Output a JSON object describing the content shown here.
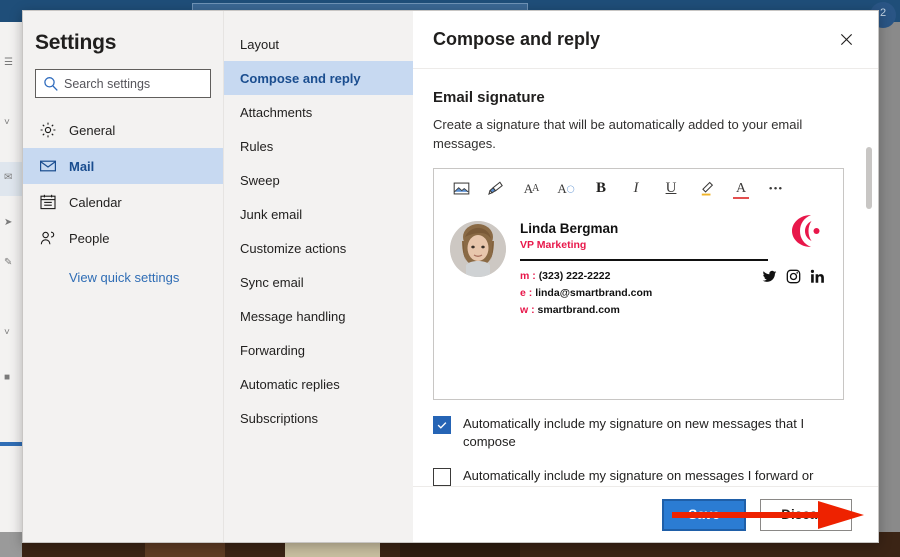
{
  "background": {
    "notification_badge": "2"
  },
  "settings": {
    "title": "Settings",
    "search": {
      "placeholder": "Search settings",
      "value": "",
      "icon": "search-icon"
    },
    "nav_items": [
      {
        "label": "General",
        "icon": "gear-icon",
        "selected": false
      },
      {
        "label": "Mail",
        "icon": "envelope-icon",
        "selected": true
      },
      {
        "label": "Calendar",
        "icon": "calendar-icon",
        "selected": false
      },
      {
        "label": "People",
        "icon": "people-icon",
        "selected": false
      }
    ],
    "quick_settings_link": "View quick settings",
    "subnav_items": [
      {
        "label": "Layout",
        "selected": false
      },
      {
        "label": "Compose and reply",
        "selected": true
      },
      {
        "label": "Attachments",
        "selected": false
      },
      {
        "label": "Rules",
        "selected": false
      },
      {
        "label": "Sweep",
        "selected": false
      },
      {
        "label": "Junk email",
        "selected": false
      },
      {
        "label": "Customize actions",
        "selected": false
      },
      {
        "label": "Sync email",
        "selected": false
      },
      {
        "label": "Message handling",
        "selected": false
      },
      {
        "label": "Forwarding",
        "selected": false
      },
      {
        "label": "Automatic replies",
        "selected": false
      },
      {
        "label": "Subscriptions",
        "selected": false
      }
    ]
  },
  "detail": {
    "title": "Compose and reply",
    "close_icon": "close-icon",
    "section_title": "Email signature",
    "section_description": "Create a signature that will be automatically added to your email messages.",
    "toolbar": [
      {
        "name": "insert-picture-icon",
        "glyph": "image"
      },
      {
        "name": "format-painter-icon",
        "glyph": "brush"
      },
      {
        "name": "font-size-icon",
        "glyph": "AA"
      },
      {
        "name": "font-grow-icon",
        "glyph": "A"
      },
      {
        "name": "bold-icon",
        "glyph": "B"
      },
      {
        "name": "italic-icon",
        "glyph": "I"
      },
      {
        "name": "underline-icon",
        "glyph": "U"
      },
      {
        "name": "highlight-icon",
        "glyph": "pen"
      },
      {
        "name": "font-color-icon",
        "glyph": "A"
      },
      {
        "name": "more-options-icon",
        "glyph": "•••"
      }
    ],
    "signature": {
      "name": "Linda Bergman",
      "role": "VP Marketing",
      "contacts": [
        {
          "key": "m",
          "value": "(323) 222-2222"
        },
        {
          "key": "e",
          "value": "linda@smartbrand.com"
        },
        {
          "key": "w",
          "value": "smartbrand.com"
        }
      ],
      "social": [
        "twitter-icon",
        "instagram-icon",
        "linkedin-icon"
      ],
      "brand_color": "#e8174a",
      "avatar_alt": "portrait-photo",
      "logo_alt": "smartbrand-logo"
    },
    "checkboxes": [
      {
        "label": "Automatically include my signature on new messages that I compose",
        "checked": true
      },
      {
        "label": "Automatically include my signature on messages I forward or",
        "checked": false
      }
    ],
    "footer": {
      "save_label": "Save",
      "discard_label": "Discard"
    }
  },
  "annotation": {
    "arrow_color": "#ee2200"
  }
}
